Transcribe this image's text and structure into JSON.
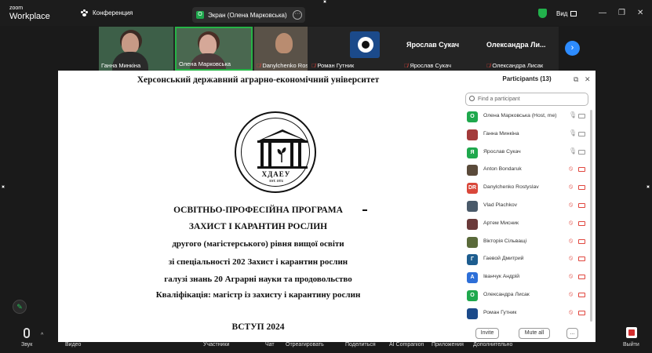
{
  "app": {
    "logo_small": "zoom",
    "logo_big": "Workplace"
  },
  "topbar": {
    "conference_label": "Конференция",
    "screen_share_label": "Экран (Олена Марковська)",
    "view_label": "Вид",
    "shield_color": "#22b14c"
  },
  "gallery": {
    "tiles": [
      {
        "name": "Ганна Минкіна",
        "muted": false
      },
      {
        "name": "Олена Марковська",
        "muted": false
      },
      {
        "name": "Danylchenko Rostyslav",
        "muted": true
      },
      {
        "name": "Роман Гутник",
        "muted": true
      },
      {
        "name": "Ярослав Сукач",
        "title": "Ярослав Сукач",
        "muted": true
      },
      {
        "name": "Олександра Лисак",
        "title": "Олександра Ли...",
        "muted": true
      }
    ],
    "active_speaker_color": "#26b446"
  },
  "document": {
    "university": "Херсонський державний аграрно-економічний університет",
    "emblem_text": "ХДАЕУ",
    "emblem_est": "EST. 1874",
    "lines": [
      "ОСВІТНЬО-ПРОФЕСІЙНА ПРОГРАМА",
      "ЗАХИСТ І КАРАНТИН РОСЛИН",
      "другого (магістерського) рівня вищої освіти",
      "зі спеціальності 202 Захист і карантин рослин",
      "галузі знань 20 Аграрні науки та продовольство",
      "Кваліфікація: магістр із захисту і карантину рослин"
    ],
    "footer": "ВСТУП 2024"
  },
  "participants": {
    "title": "Participants (13)",
    "search_placeholder": "Find a participant",
    "list": [
      {
        "name": "Олена Марковська (Host, me)",
        "avatar": "О",
        "color": "#1fa84d",
        "muted": false
      },
      {
        "name": "Ганна Минкіна",
        "avatar": "",
        "color": "#a33b3b",
        "muted": false
      },
      {
        "name": "Ярослав Сукач",
        "avatar": "Я",
        "color": "#1fa84d",
        "muted": false
      },
      {
        "name": "Anton Bondaruk",
        "avatar": "",
        "color": "#5a4a3a",
        "muted": true
      },
      {
        "name": "Danylchenko Rostyslav",
        "avatar": "DR",
        "color": "#d9473a",
        "muted": true
      },
      {
        "name": "Vlad Plachkov",
        "avatar": "",
        "color": "#4a5a6a",
        "muted": true
      },
      {
        "name": "Артем Мисник",
        "avatar": "",
        "color": "#6a3a3a",
        "muted": true
      },
      {
        "name": "Вікторія Сільващі",
        "avatar": "",
        "color": "#5a6a3a",
        "muted": true
      },
      {
        "name": "Гаевой Дмитрий",
        "avatar": "Г",
        "color": "#1d5d8f",
        "muted": true
      },
      {
        "name": "Іванчук Андрій",
        "avatar": "А",
        "color": "#2d6fd8",
        "muted": true
      },
      {
        "name": "Олександра Лисак",
        "avatar": "О",
        "color": "#1fa84d",
        "muted": true
      },
      {
        "name": "Роман Гутник",
        "avatar": "",
        "color": "#1b4a8a",
        "muted": true
      }
    ],
    "invite_label": "Invite",
    "mute_all_label": "Mute all",
    "more_label": "..."
  },
  "bottombar": {
    "items": [
      "Звук",
      "Видео",
      "Участники",
      "Чат",
      "Отреагировать",
      "Поделиться",
      "AI Companion",
      "Приложения",
      "Дополнительно",
      "Выйти"
    ]
  }
}
